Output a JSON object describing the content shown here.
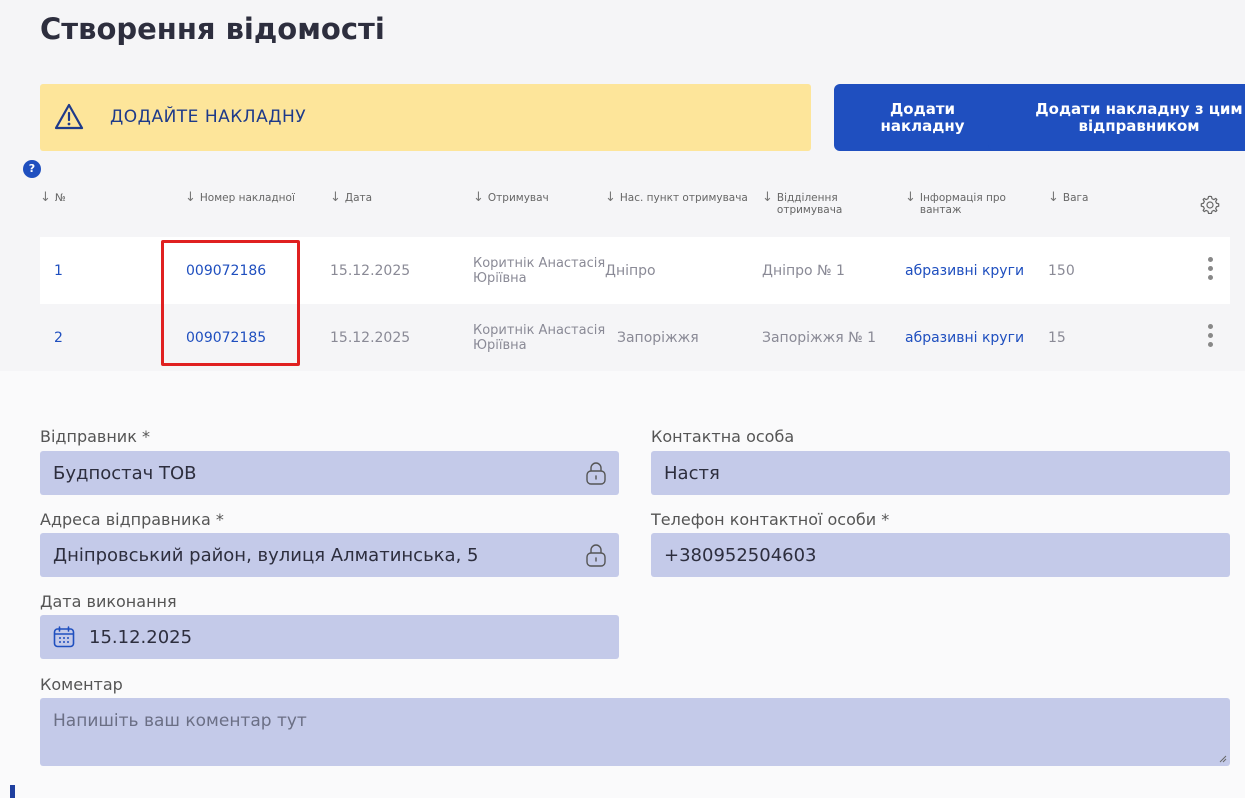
{
  "page": {
    "title": "Створення відомості"
  },
  "warning": {
    "text": "ДОДАЙТЕ НАКЛАДНУ"
  },
  "buttons": {
    "add": "Додати накладну",
    "add_with_sender": "Додати накладну з цим відправником"
  },
  "help_label": "?",
  "table": {
    "columns": [
      "№",
      "Номер накладної",
      "Дата",
      "Отримувач",
      "Нас. пункт отримувача",
      "Відділення отримувача",
      "Інформація про вантаж",
      "Вага"
    ],
    "rows": [
      {
        "num": "1",
        "invoice": "009072186",
        "date": "15.12.2025",
        "recipient": "Коритнік Анастасія Юріївна",
        "city": "Дніпро",
        "branch": "Дніпро № 1",
        "cargo": "абразивні круги",
        "weight": "150"
      },
      {
        "num": "2",
        "invoice": "009072185",
        "date": "15.12.2025",
        "recipient": "Коритнік Анастасія Юріївна",
        "city": "Запоріжжя",
        "branch": "Запоріжжя № 1",
        "cargo": "абразивні круги",
        "weight": "15"
      }
    ]
  },
  "form": {
    "sender_label": "Відправник *",
    "sender_value": "Будпостач ТОВ",
    "contact_label": "Контактна особа",
    "contact_value": "Настя",
    "address_label": "Адреса відправника *",
    "address_value": "Дніпровський район, вулиця Алматинська, 5",
    "phone_label": "Телефон контактної особи *",
    "phone_value": "+380952504603",
    "date_label": "Дата виконання",
    "date_value": "15.12.2025",
    "comment_label": "Коментар",
    "comment_placeholder": "Напишіть ваш коментар тут"
  },
  "icons": {
    "warning": "warning-triangle-icon",
    "settings": "gear-icon",
    "lock": "lock-icon",
    "calendar": "calendar-icon",
    "menu": "kebab-menu-icon"
  },
  "colors": {
    "primary": "#1f4fbf",
    "warning_bg": "#fde59a",
    "field_bg": "#c4cae9",
    "highlight": "#e02020"
  }
}
